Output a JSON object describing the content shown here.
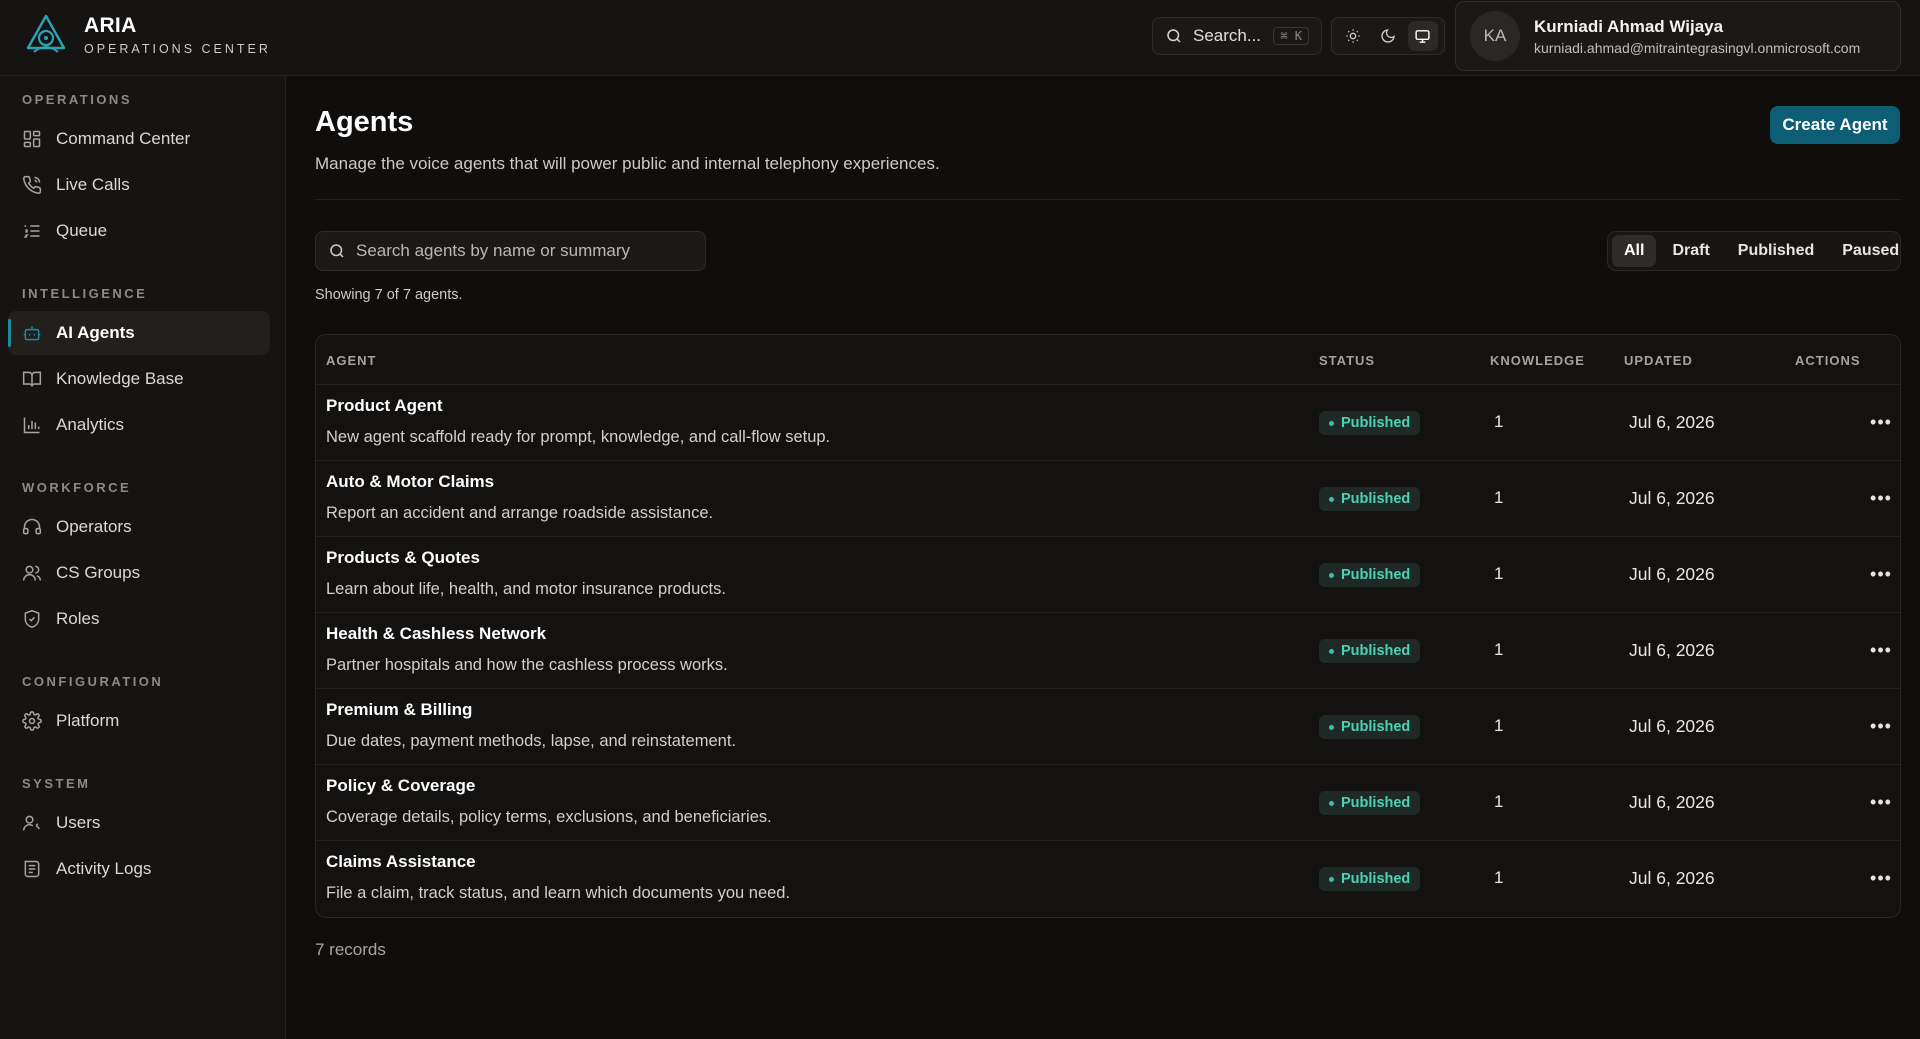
{
  "brand": {
    "name": "ARIA",
    "subtitle": "OPERATIONS CENTER"
  },
  "header": {
    "search_label": "Search...",
    "search_shortcut": "⌘ K",
    "theme_options": [
      "light",
      "dark",
      "system"
    ],
    "theme_selected": "system",
    "user": {
      "initials": "KA",
      "name": "Kurniadi Ahmad Wijaya",
      "email": "kurniadi.ahmad@mitraintegrasingvl.onmicrosoft.com"
    }
  },
  "sidebar": {
    "sections": [
      {
        "title": "OPERATIONS",
        "items": [
          {
            "label": "Command Center",
            "icon": "grid-icon"
          },
          {
            "label": "Live Calls",
            "icon": "phone-icon"
          },
          {
            "label": "Queue",
            "icon": "list-icon"
          }
        ]
      },
      {
        "title": "INTELLIGENCE",
        "items": [
          {
            "label": "AI Agents",
            "icon": "bot-icon",
            "active": true
          },
          {
            "label": "Knowledge Base",
            "icon": "book-icon"
          },
          {
            "label": "Analytics",
            "icon": "bar-chart-icon"
          }
        ]
      },
      {
        "title": "WORKFORCE",
        "items": [
          {
            "label": "Operators",
            "icon": "headset-icon"
          },
          {
            "label": "CS Groups",
            "icon": "users-icon"
          },
          {
            "label": "Roles",
            "icon": "shield-icon"
          }
        ]
      },
      {
        "title": "CONFIGURATION",
        "items": [
          {
            "label": "Platform",
            "icon": "gear-icon"
          }
        ]
      },
      {
        "title": "SYSTEM",
        "items": [
          {
            "label": "Users",
            "icon": "user-key-icon"
          },
          {
            "label": "Activity Logs",
            "icon": "logs-icon"
          }
        ]
      }
    ]
  },
  "main": {
    "title": "Agents",
    "description": "Manage the voice agents that will power public and internal telephony experiences.",
    "create_label": "Create Agent",
    "search_placeholder": "Search agents by name or summary",
    "showing_text": "Showing 7 of 7 agents.",
    "filters": [
      "All",
      "Draft",
      "Published",
      "Paused"
    ],
    "filter_selected": "All",
    "columns": [
      "AGENT",
      "STATUS",
      "KNOWLEDGE",
      "UPDATED",
      "ACTIONS"
    ],
    "rows": [
      {
        "name": "Product Agent",
        "summary": "New agent scaffold ready for prompt, knowledge, and call-flow setup.",
        "status": "Published",
        "knowledge": "1",
        "updated": "Jul 6, 2026"
      },
      {
        "name": "Auto & Motor Claims",
        "summary": "Report an accident and arrange roadside assistance.",
        "status": "Published",
        "knowledge": "1",
        "updated": "Jul 6, 2026"
      },
      {
        "name": "Products & Quotes",
        "summary": "Learn about life, health, and motor insurance products.",
        "status": "Published",
        "knowledge": "1",
        "updated": "Jul 6, 2026"
      },
      {
        "name": "Health & Cashless Network",
        "summary": "Partner hospitals and how the cashless process works.",
        "status": "Published",
        "knowledge": "1",
        "updated": "Jul 6, 2026"
      },
      {
        "name": "Premium & Billing",
        "summary": "Due dates, payment methods, lapse, and reinstatement.",
        "status": "Published",
        "knowledge": "1",
        "updated": "Jul 6, 2026"
      },
      {
        "name": "Policy & Coverage",
        "summary": "Coverage details, policy terms, exclusions, and beneficiaries.",
        "status": "Published",
        "knowledge": "1",
        "updated": "Jul 6, 2026"
      },
      {
        "name": "Claims Assistance",
        "summary": "File a claim, track status, and learn which documents you need.",
        "status": "Published",
        "knowledge": "1",
        "updated": "Jul 6, 2026"
      }
    ],
    "records_text": "7 records"
  },
  "colors": {
    "accent": "#0d5d75",
    "status_published": "#4fd1b5",
    "background": "#0f0e0d"
  }
}
